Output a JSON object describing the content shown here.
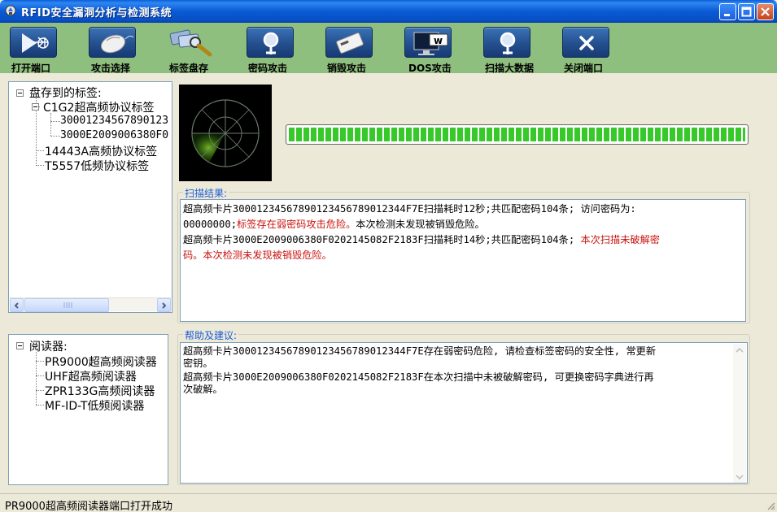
{
  "window": {
    "title": "RFID安全漏洞分析与检测系统"
  },
  "toolbar": {
    "buttons": [
      {
        "label": "打开端口",
        "icon": "play-arrow-icon"
      },
      {
        "label": "攻击选择",
        "icon": "mouse-icon"
      },
      {
        "label": "标签盘存",
        "icon": "tag-scan-icon"
      },
      {
        "label": "密码攻击",
        "icon": "magnifier-icon"
      },
      {
        "label": "销毁攻击",
        "icon": "card-icon"
      },
      {
        "label": "DOS攻击",
        "icon": "monitor-icon"
      },
      {
        "label": "扫描大数据",
        "icon": "magnifier-icon"
      },
      {
        "label": "关闭端口",
        "icon": "close-x-icon"
      }
    ]
  },
  "tag_tree": {
    "root": "盘存到的标签:",
    "groups": [
      {
        "label": "C1G2超高频协议标签",
        "children": [
          "30001234567890123",
          "3000E2009006380F0"
        ]
      },
      {
        "label": "14443A高频协议标签",
        "children": []
      },
      {
        "label": "T5557低频协议标签",
        "children": []
      }
    ]
  },
  "reader_tree": {
    "root": "阅读器:",
    "items": [
      "PR9000超高频阅读器",
      "UHF超高频阅读器",
      "ZPR133G高频阅读器",
      "MF-ID-T低频阅读器"
    ]
  },
  "progress": {
    "value": 1.0
  },
  "scan_results": {
    "label": "扫描结果:",
    "line1": "超高频卡片30001234567890123456789012344F7E扫描耗时12秒;共匹配密码104条; 访问密码为:",
    "line2_normal": "00000000;",
    "line2_red": "标签存在弱密码攻击危险。",
    "line2_tail": "本次检测未发现被销毁危险。",
    "line3_normal": "超高频卡片3000E2009006380F0202145082F2183F扫描耗时14秒;共匹配密码104条; ",
    "line3_red": "本次扫描未破解密",
    "line4_red": "码。本次检测未发现被销毁危险。"
  },
  "help": {
    "label": "帮助及建议:",
    "line1": "超高频卡片30001234567890123456789012344F7E存在弱密码危险, 请检查标签密码的安全性, 常更新",
    "line2": "密钥。",
    "line3": "超高频卡片3000E2009006380F0202145082F2183F在本次扫描中未被破解密码, 可更换密码字典进行再",
    "line4": "次破解。"
  },
  "status": {
    "text": "PR9000超高频阅读器端口打开成功"
  },
  "colors": {
    "titlebar": "#0a5ad4",
    "toolbar_bg": "#8fbf7e",
    "warning_red": "#c8140f",
    "group_label_blue": "#1d5ed8",
    "progress_green": "#37c92a"
  }
}
